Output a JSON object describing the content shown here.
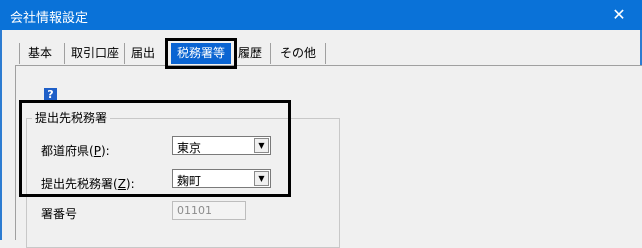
{
  "window": {
    "title": "会社情報設定",
    "close_glyph": "✕"
  },
  "tabs": [
    {
      "label": "基本"
    },
    {
      "label": "取引口座"
    },
    {
      "label": "届出"
    },
    {
      "label": "税務署等"
    },
    {
      "label": "履歴"
    },
    {
      "label": "その他"
    }
  ],
  "selected_tab": "税務署等",
  "help": {
    "glyph": "?"
  },
  "group": {
    "title": "提出先税務署"
  },
  "prefecture": {
    "label_prefix": "都道府県(",
    "accel": "P",
    "label_suffix": "):",
    "value": "東京"
  },
  "tax_office": {
    "label_prefix": "提出先税務署(",
    "accel": "Z",
    "label_suffix": "):",
    "value": "麹町"
  },
  "office_number": {
    "label": "署番号",
    "value": "01101"
  },
  "dropdown_glyph": "▼",
  "colors": {
    "titlebar": "#0a72d8",
    "selected_tab": "#0a64d2",
    "help_icon": "#1e5fc8"
  }
}
